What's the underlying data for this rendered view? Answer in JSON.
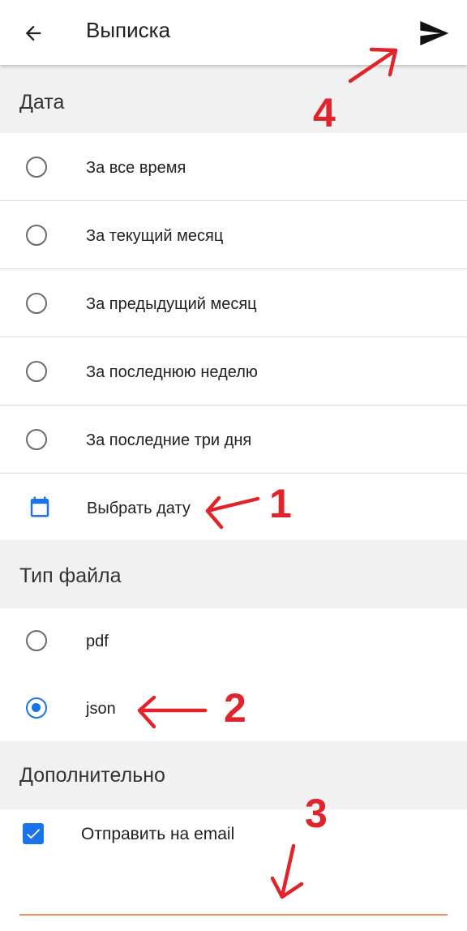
{
  "header": {
    "title": "Выписка"
  },
  "sections": {
    "date": {
      "title": "Дата",
      "options": [
        {
          "label": "За все время",
          "selected": false
        },
        {
          "label": "За текущий месяц",
          "selected": false
        },
        {
          "label": "За предыдущий месяц",
          "selected": false
        },
        {
          "label": "За последнюю неделю",
          "selected": false
        },
        {
          "label": "За последние три дня",
          "selected": false
        }
      ],
      "pick_date_label": "Выбрать дату"
    },
    "file_type": {
      "title": "Тип файла",
      "options": [
        {
          "label": "pdf",
          "selected": false
        },
        {
          "label": "json",
          "selected": true
        }
      ]
    },
    "extra": {
      "title": "Дополнительно",
      "send_email_label": "Отправить на email",
      "send_email_checked": true
    }
  },
  "annotations": [
    "1",
    "2",
    "3",
    "4"
  ],
  "colors": {
    "accent": "#1a73e8",
    "annotation": "#e0242c",
    "underline": "#f28b54",
    "section_bg": "#f1f1f1"
  }
}
